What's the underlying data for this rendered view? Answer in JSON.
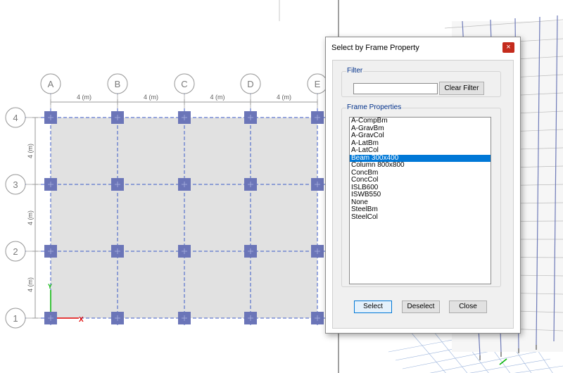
{
  "plan": {
    "column_grid_labels": [
      "A",
      "B",
      "C",
      "D",
      "E"
    ],
    "row_grid_labels": [
      "4",
      "3",
      "2",
      "1"
    ],
    "spacing_label": "4 (m)",
    "axis_x_label": "X",
    "axis_y_label": "Y",
    "colors": {
      "grid_line": "#3c5ac8",
      "joint": "#6b75b8",
      "slab": "#e1e1e1",
      "bubble": "#969696"
    }
  },
  "dialog": {
    "title": "Select by Frame Property",
    "close_glyph": "×",
    "filter_group_label": "Filter",
    "filter_value": "",
    "clear_filter_label": "Clear Filter",
    "list_group_label": "Frame Properties",
    "properties": [
      "A-CompBm",
      "A-GravBm",
      "A-GravCol",
      "A-LatBm",
      "A-LatCol",
      "Beam 300x400",
      "Column 800x800",
      "ConcBm",
      "ConcCol",
      "ISLB600",
      "ISWB550",
      "None",
      "SteelBm",
      "SteelCol"
    ],
    "selected_property": "Beam 300x400",
    "select_label": "Select",
    "deselect_label": "Deselect",
    "close_label": "Close",
    "colors": {
      "selection": "#0078d7",
      "close_button": "#c42b1c",
      "group_label": "#00308a"
    }
  }
}
